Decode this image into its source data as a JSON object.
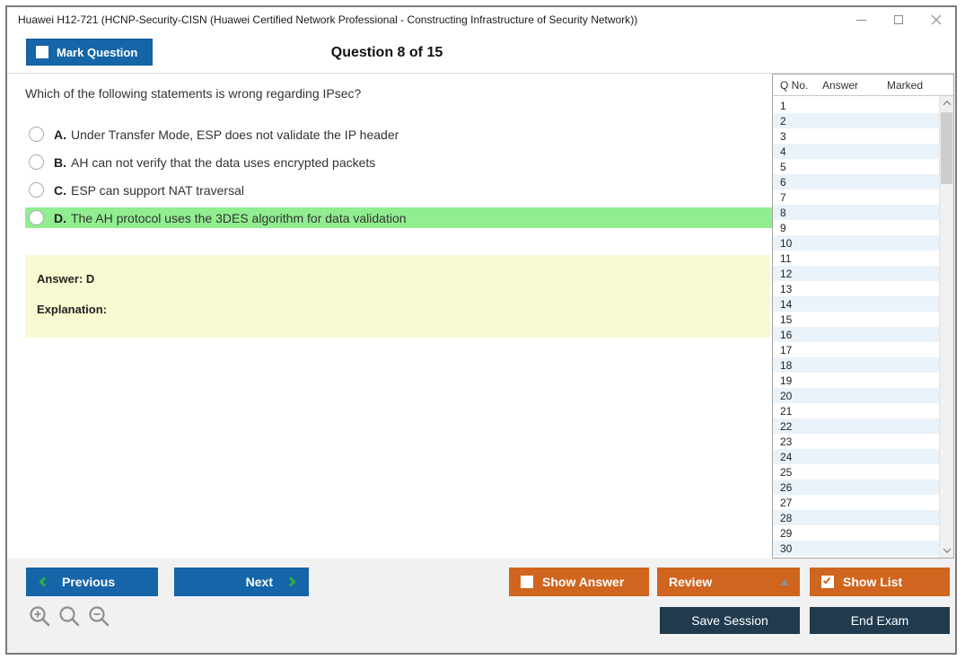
{
  "window": {
    "title": "Huawei H12-721 (HCNP-Security-CISN (Huawei Certified Network Professional - Constructing Infrastructure of Security Network))"
  },
  "header": {
    "mark_question_label": "Mark Question",
    "question_counter": "Question 8 of 15"
  },
  "question": {
    "text": "Which of the following statements is wrong regarding IPsec?",
    "options": [
      {
        "letter": "A.",
        "text": "Under Transfer Mode, ESP does not validate the IP header",
        "highlighted": false
      },
      {
        "letter": "B.",
        "text": "AH can not verify that the data uses encrypted packets",
        "highlighted": false
      },
      {
        "letter": "C.",
        "text": "ESP can support NAT traversal",
        "highlighted": false
      },
      {
        "letter": "D.",
        "text": "The AH protocol uses the 3DES algorithm for data validation",
        "highlighted": true
      }
    ],
    "answer_label": "Answer: D",
    "explanation_label": "Explanation:"
  },
  "question_list": {
    "columns": [
      "Q No.",
      "Answer",
      "Marked"
    ],
    "rows": [
      "1",
      "2",
      "3",
      "4",
      "5",
      "6",
      "7",
      "8",
      "9",
      "10",
      "11",
      "12",
      "13",
      "14",
      "15",
      "16",
      "17",
      "18",
      "19",
      "20",
      "21",
      "22",
      "23",
      "24",
      "25",
      "26",
      "27",
      "28",
      "29",
      "30"
    ]
  },
  "footer": {
    "previous_label": "Previous",
    "next_label": "Next",
    "show_answer_label": "Show Answer",
    "review_label": "Review",
    "show_list_label": "Show List",
    "save_session_label": "Save Session",
    "end_exam_label": "End Exam"
  },
  "icons": {
    "minimize": "minimize-line",
    "maximize": "square-outline",
    "close": "x-cross",
    "mark_question_checkbox": "checkbox-unchecked",
    "show_answer_checkbox": "checkbox-unchecked",
    "show_list_checkbox": "checkbox-checked",
    "previous": "chevron-left",
    "next": "chevron-right",
    "review_dropdown": "triangle-up",
    "scroll_up": "chevron-up",
    "scroll_down": "chevron-down",
    "zoom_in": "magnifier-plus",
    "zoom_reset": "magnifier",
    "zoom_out": "magnifier-minus"
  },
  "colors": {
    "primary_blue": "#1565a8",
    "accent_orange": "#d0651f",
    "dark_navy": "#203b4e",
    "highlight_green": "#90ee90",
    "answer_yellow": "#fafad2",
    "list_alt_row": "#eaf2fa"
  }
}
